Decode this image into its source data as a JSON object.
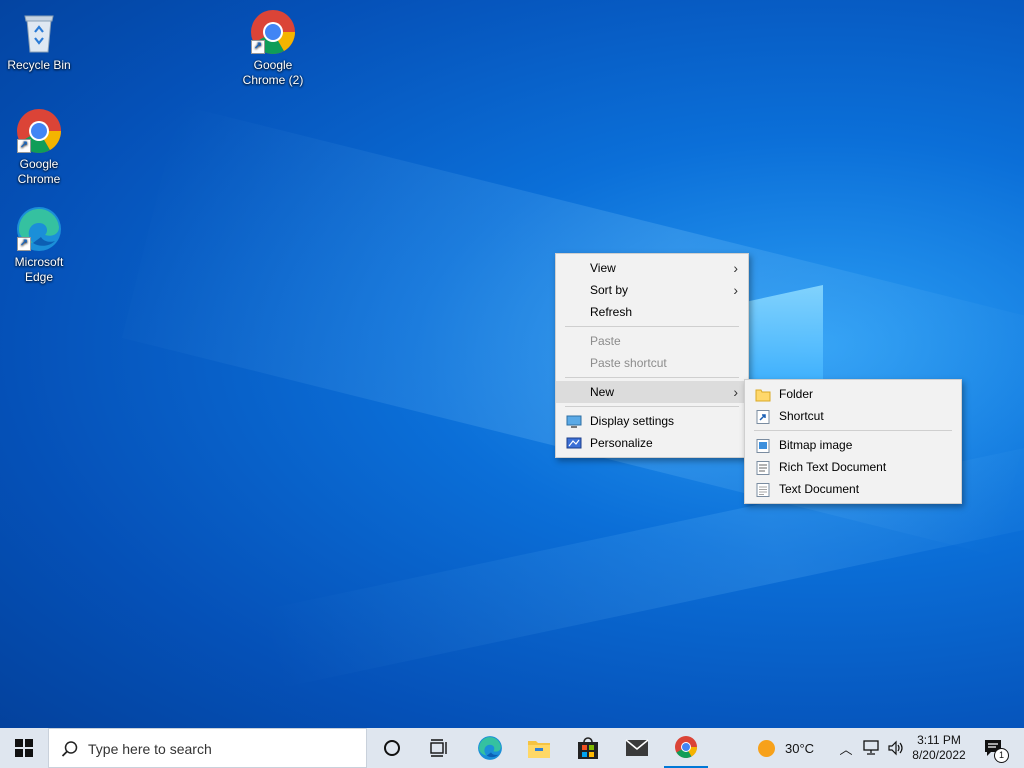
{
  "desktop": {
    "icons": [
      {
        "label": "Recycle Bin",
        "icon": "recycle-bin-icon"
      },
      {
        "label": "Google Chrome (2)",
        "icon": "chrome-icon"
      },
      {
        "label": "Google Chrome",
        "icon": "chrome-icon"
      },
      {
        "label": "Microsoft Edge",
        "icon": "edge-icon"
      }
    ]
  },
  "context_menu": {
    "items": [
      {
        "label": "View",
        "submenu": true
      },
      {
        "label": "Sort by",
        "submenu": true
      },
      {
        "label": "Refresh"
      },
      {
        "label": "Paste",
        "disabled": true
      },
      {
        "label": "Paste shortcut",
        "disabled": true
      },
      {
        "label": "New",
        "submenu": true,
        "highlighted": true
      },
      {
        "label": "Display settings",
        "icon": "display-settings-icon"
      },
      {
        "label": "Personalize",
        "icon": "personalize-icon"
      }
    ]
  },
  "new_submenu": {
    "items": [
      {
        "label": "Folder",
        "icon": "folder-icon"
      },
      {
        "label": "Shortcut",
        "icon": "shortcut-icon"
      },
      {
        "label": "Bitmap image",
        "icon": "bitmap-image-icon"
      },
      {
        "label": "Rich Text Document",
        "icon": "rich-text-document-icon"
      },
      {
        "label": "Text Document",
        "icon": "text-document-icon"
      }
    ]
  },
  "taskbar": {
    "search_placeholder": "Type here to search",
    "pinned": [
      "edge-icon",
      "file-explorer-icon",
      "store-icon",
      "mail-icon",
      "chrome-icon"
    ],
    "weather_temp": "30°C",
    "time": "3:11 PM",
    "date": "8/20/2022",
    "notification_count": "1",
    "accent": "#0078d7"
  }
}
